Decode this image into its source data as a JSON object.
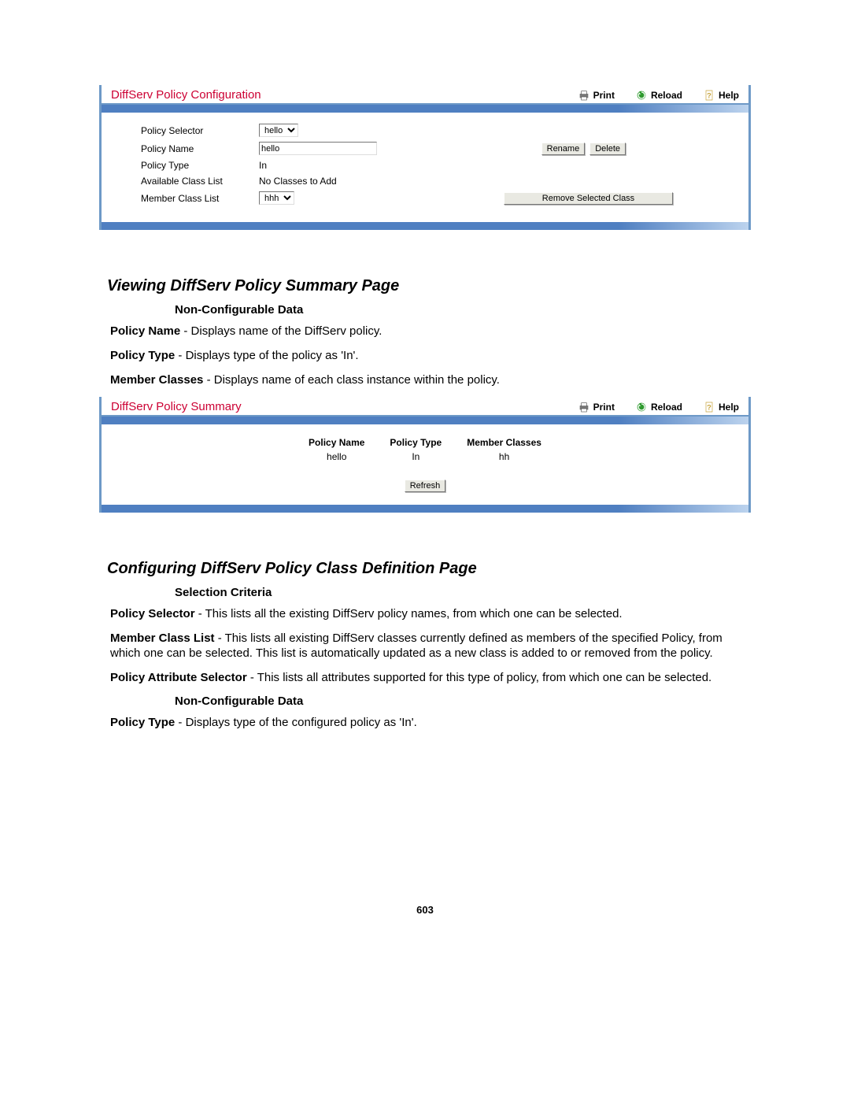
{
  "colors": {
    "accent": "#cc0033",
    "blue": "#4f7fc1"
  },
  "header_actions": {
    "print": "Print",
    "reload": "Reload",
    "help": "Help"
  },
  "panel1": {
    "title": "DiffServ Policy Configuration",
    "labels": {
      "policy_selector": "Policy Selector",
      "policy_name": "Policy Name",
      "policy_type": "Policy Type",
      "available_class_list": "Available Class List",
      "member_class_list": "Member Class List"
    },
    "values": {
      "policy_selector_selected": "hello",
      "policy_name_value": "hello",
      "policy_type_value": "In",
      "available_class_list_value": "No Classes to Add",
      "member_class_list_selected": "hhh"
    },
    "buttons": {
      "rename": "Rename",
      "delete": "Delete",
      "remove_selected_class": "Remove Selected Class"
    }
  },
  "doc_section1": {
    "h2": "Viewing DiffServ Policy Summary Page",
    "h3": "Non-Configurable Data",
    "p1_label": "Policy Name",
    "p1_text": " - Displays name of the DiffServ policy.",
    "p2_label": "Policy Type",
    "p2_text": " - Displays type of the policy as 'In'.",
    "p3_label": "Member Classes",
    "p3_text": " - Displays name of each class instance within the policy."
  },
  "panel2": {
    "title": "DiffServ Policy Summary",
    "table": {
      "headers": [
        "Policy Name",
        "Policy Type",
        "Member Classes"
      ],
      "rows": [
        [
          "hello",
          "In",
          "hh"
        ]
      ]
    },
    "refresh_button": "Refresh"
  },
  "doc_section2": {
    "h2": "Configuring DiffServ Policy Class Definition Page",
    "h3a": "Selection Criteria",
    "p1_label": "Policy Selector",
    "p1_text": " - This lists all the existing DiffServ policy names, from which one can be selected.",
    "p2_label": "Member Class List",
    "p2_text": " - This lists all existing DiffServ classes currently defined as members of the specified Policy, from which one can be selected. This list is automatically updated as a new class is added to or removed from the policy.",
    "p3_label": "Policy Attribute Selector",
    "p3_text": " - This lists all attributes supported for this type of policy, from which one can be selected.",
    "h3b": "Non-Configurable Data",
    "p4_label": "Policy Type",
    "p4_text": " - Displays type of the configured policy as 'In'."
  },
  "page_number": "603"
}
